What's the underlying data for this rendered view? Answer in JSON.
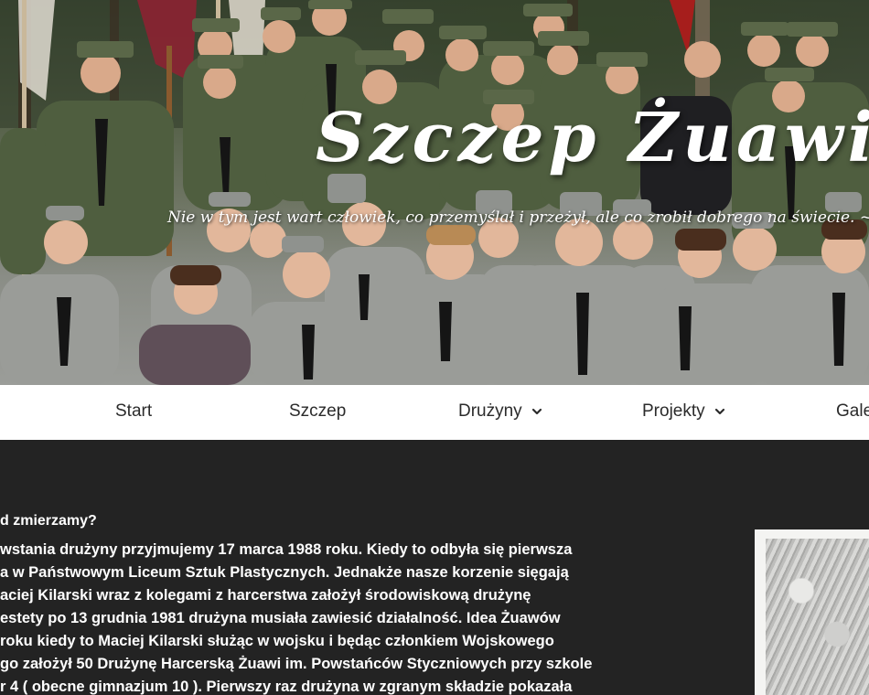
{
  "hero": {
    "title": "Szczep Żuawi",
    "motto": "Nie w tym jest wart człowiek, co przemyślał i przeżył, ale co zrobił dobrego na świecie. ~"
  },
  "nav": {
    "items": [
      {
        "label": "Start",
        "has_dropdown": false
      },
      {
        "label": "Szczep",
        "has_dropdown": false
      },
      {
        "label": "Drużyny",
        "has_dropdown": true
      },
      {
        "label": "Projekty",
        "has_dropdown": true
      },
      {
        "label": "Gale",
        "has_dropdown": false
      }
    ]
  },
  "content": {
    "heading": "d zmierzamy?",
    "paragraph_lines": [
      "wstania drużyny przyjmujemy 17 marca 1988 roku. Kiedy to odbyła się pierwsza",
      "a w Państwowym Liceum Sztuk Plastycznych. Jednakże nasze korzenie sięgają",
      "aciej Kilarski wraz z kolegami z harcerstwa założył środowiskową drużynę",
      "estety po 13 grudnia 1981 drużyna musiała zawiesić działalność. Idea Żuawów",
      "roku kiedy to Maciej Kilarski służąc w wojsku i będąc członkiem Wojskowego",
      "go założył 50 Drużynę Harcerską Żuawi im. Powstańców Styczniowych przy szkole",
      "r 4 ( obecne gimnazjum 10 ). Pierwszy raz drużyna w zgranym składzie pokazała"
    ]
  },
  "colors": {
    "page_background": "#232323",
    "nav_background": "#ffffff",
    "nav_text": "#2b2b2b",
    "content_text": "#ffffff",
    "uniform_green": "#4f5e3f",
    "uniform_grey": "#9a9c98"
  },
  "icons": {
    "dropdown": "chevron-down-icon"
  }
}
